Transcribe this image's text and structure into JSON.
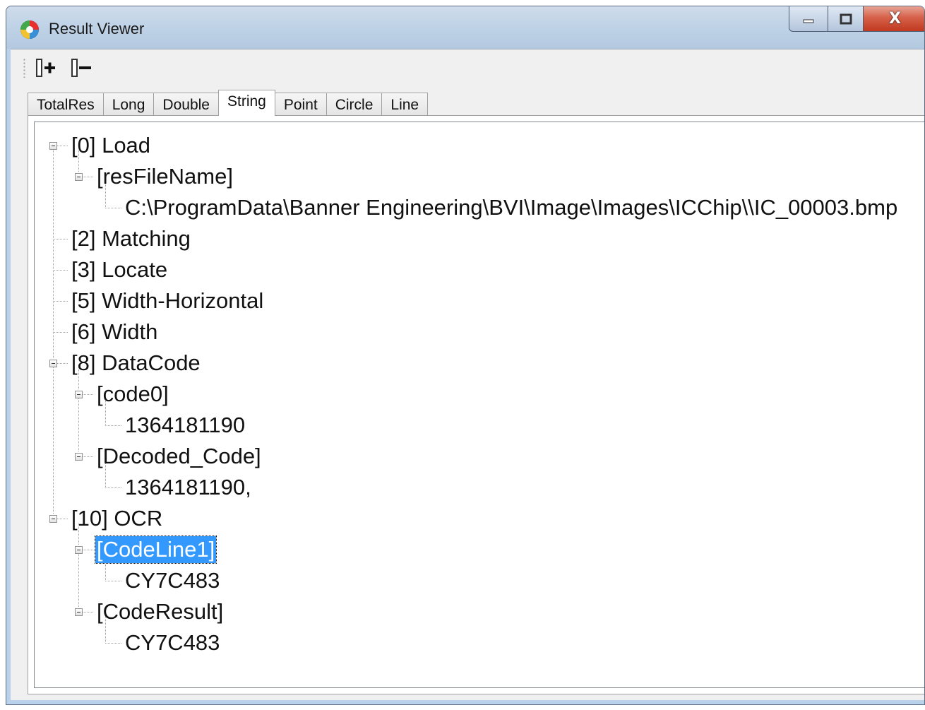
{
  "window": {
    "title": "Result Viewer"
  },
  "titlebar_buttons": {
    "minimize_icon": "minimize-icon",
    "maximize_icon": "maximize-icon",
    "close_label": "X"
  },
  "toolbar": {
    "expand_all_icon": "expand-all-icon",
    "collapse_all_icon": "collapse-all-icon"
  },
  "tabs": [
    {
      "label": "TotalRes",
      "active": false
    },
    {
      "label": "Long",
      "active": false
    },
    {
      "label": "Double",
      "active": false
    },
    {
      "label": "String",
      "active": true
    },
    {
      "label": "Point",
      "active": false
    },
    {
      "label": "Circle",
      "active": false
    },
    {
      "label": "Line",
      "active": false
    }
  ],
  "tree": {
    "nodes": [
      {
        "label": "[0] Load",
        "level": 0,
        "expanded": true
      },
      {
        "label": "[resFileName]",
        "level": 1,
        "expanded": true
      },
      {
        "label": "C:\\ProgramData\\Banner Engineering\\BVI\\Image\\Images\\ICChip\\\\IC_00003.bmp",
        "level": 2
      },
      {
        "label": "[2] Matching",
        "level": 0
      },
      {
        "label": "[3] Locate",
        "level": 0
      },
      {
        "label": "[5] Width-Horizontal",
        "level": 0
      },
      {
        "label": "[6] Width",
        "level": 0
      },
      {
        "label": "[8] DataCode",
        "level": 0,
        "expanded": true
      },
      {
        "label": "[code0]",
        "level": 1,
        "expanded": true
      },
      {
        "label": "1364181190",
        "level": 2
      },
      {
        "label": "[Decoded_Code]",
        "level": 1,
        "expanded": true
      },
      {
        "label": "1364181190,",
        "level": 2
      },
      {
        "label": "[10] OCR",
        "level": 0,
        "expanded": true
      },
      {
        "label": "[CodeLine1]",
        "level": 1,
        "expanded": true,
        "selected": true
      },
      {
        "label": "CY7C483",
        "level": 2
      },
      {
        "label": "[CodeResult]",
        "level": 1,
        "expanded": true
      },
      {
        "label": "CY7C483",
        "level": 2
      }
    ]
  },
  "colors": {
    "selection": "#3399ff",
    "titlebar": "#c0d3e7",
    "close_button": "#c7432a"
  }
}
